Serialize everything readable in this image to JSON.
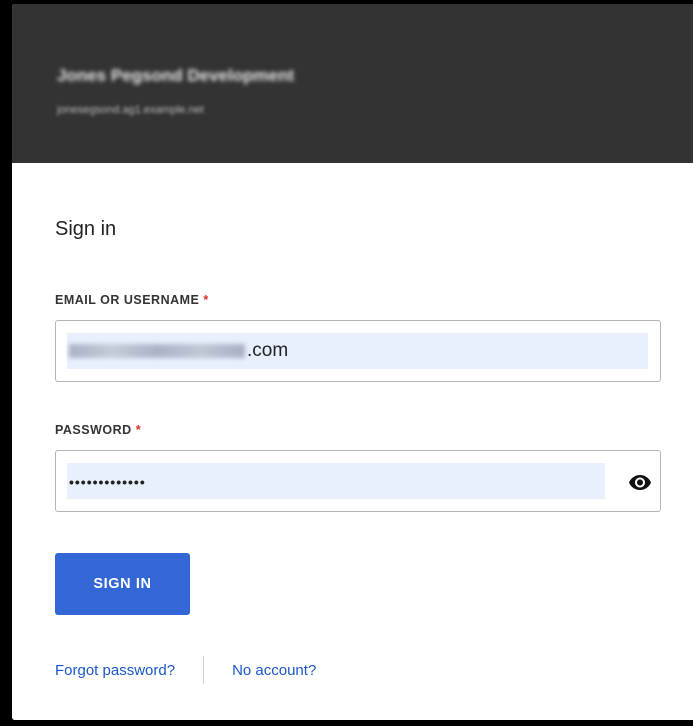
{
  "header": {
    "org_name": "Jones Pegsond Development",
    "org_subtitle": "jonesegsond.ag1.example.net"
  },
  "form": {
    "title": "Sign in",
    "email": {
      "label": "EMAIL OR USERNAME",
      "required_marker": "*",
      "value_visible": ".com"
    },
    "password": {
      "label": "PASSWORD",
      "required_marker": "*",
      "value_masked": "•••••••••••••",
      "toggle_icon": "eye-icon"
    },
    "submit_label": "SIGN IN"
  },
  "links": {
    "forgot_password": "Forgot password?",
    "no_account": "No account?"
  },
  "colors": {
    "header_bg": "#333333",
    "primary": "#3367d6",
    "link": "#1a57c8",
    "required": "#d93025",
    "autofill_bg": "#e8f0fe"
  }
}
